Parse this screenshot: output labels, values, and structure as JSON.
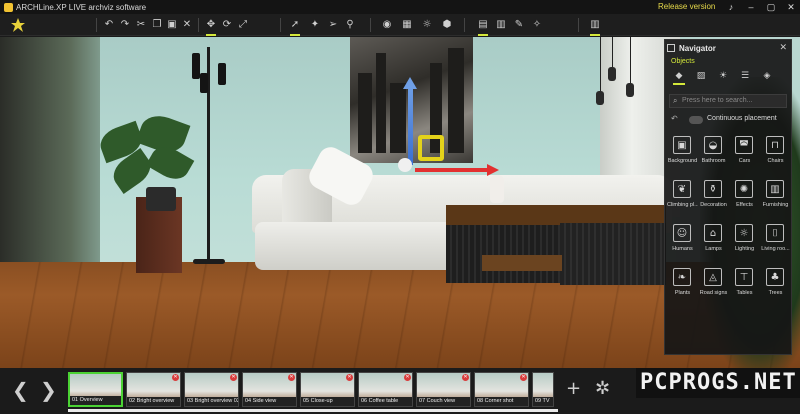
{
  "window": {
    "title": "ARCHLine.XP LIVE archviz software",
    "release_label": "Release version",
    "controls": [
      "bell-icon",
      "minimize-icon",
      "maximize-icon",
      "close-icon"
    ]
  },
  "toolbar": {
    "groups": [
      [
        "undo-icon",
        "redo-icon",
        "cut-icon",
        "copy-icon",
        "paste-icon",
        "delete-icon"
      ],
      [
        "move-icon",
        "rotate-icon",
        "scale-icon"
      ],
      [
        "select-icon",
        "walk-icon",
        "fly-icon",
        "pin-icon"
      ],
      [
        "camera-icon",
        "render-icon",
        "light-icon",
        "material-icon"
      ],
      [
        "scene-icon",
        "layers-icon",
        "paint-icon",
        "settings-icon"
      ],
      [
        "library-icon"
      ]
    ],
    "active": [
      "move-icon",
      "select-icon",
      "scene-icon",
      "library-icon"
    ]
  },
  "navigator": {
    "title": "Navigator",
    "subtitle": "Objects",
    "tabs": [
      "cube-icon",
      "hatch-icon",
      "bulb-icon",
      "list-icon",
      "stack-icon"
    ],
    "search_placeholder": "Press here to search...",
    "continuous_label": "Continuous placement",
    "items": [
      {
        "label": "Background",
        "icon": "picture-icon"
      },
      {
        "label": "Bathroom",
        "icon": "bath-icon"
      },
      {
        "label": "Cars",
        "icon": "car-icon"
      },
      {
        "label": "Chairs",
        "icon": "chair-icon"
      },
      {
        "label": "Climbing pl...",
        "icon": "vine-icon"
      },
      {
        "label": "Decoration",
        "icon": "vase-icon"
      },
      {
        "label": "Effects",
        "icon": "sparkle-icon"
      },
      {
        "label": "Furnishing",
        "icon": "cabinet-icon"
      },
      {
        "label": "Humans",
        "icon": "person-icon"
      },
      {
        "label": "Lamps",
        "icon": "lamp-icon"
      },
      {
        "label": "Lighting",
        "icon": "spotlight-icon"
      },
      {
        "label": "Living roo...",
        "icon": "sofa-icon"
      },
      {
        "label": "Plants",
        "icon": "leaf-icon"
      },
      {
        "label": "Road signs",
        "icon": "sign-icon"
      },
      {
        "label": "Tables",
        "icon": "table-icon"
      },
      {
        "label": "Trees",
        "icon": "tree-icon"
      }
    ]
  },
  "bottom": {
    "thumbnails": [
      {
        "label": "01 Overview",
        "active": true
      },
      {
        "label": "02 Bright overview",
        "active": false
      },
      {
        "label": "03 Bright overview 02",
        "active": false
      },
      {
        "label": "04 Side view",
        "active": false
      },
      {
        "label": "05 Close-up",
        "active": false
      },
      {
        "label": "06 Coffee table",
        "active": false
      },
      {
        "label": "07 Couch view",
        "active": false
      },
      {
        "label": "08 Corner shot",
        "active": false
      },
      {
        "label": "09 TV",
        "active": false
      }
    ],
    "prev_arrow": "❮",
    "next_arrow": "❯",
    "add_symbol": "+",
    "watermark": "PCPROGS.NET"
  },
  "colors": {
    "accent": "#d4e83a",
    "active_thumb": "#4bd334",
    "release": "#e6d94a"
  }
}
